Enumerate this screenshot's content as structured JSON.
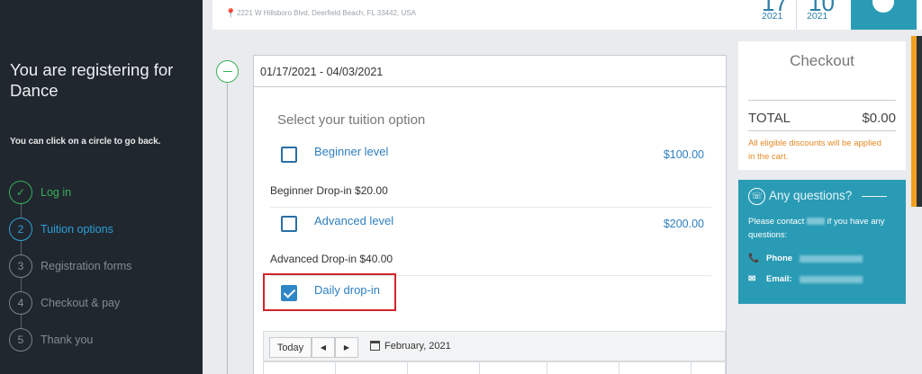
{
  "sidebar": {
    "title": "You are registering for Dance",
    "hint": "You can click on a circle to go back.",
    "steps": [
      {
        "num": "✓",
        "label": "Log in",
        "state": "done"
      },
      {
        "num": "2",
        "label": "Tuition options",
        "state": "active"
      },
      {
        "num": "3",
        "label": "Registration forms",
        "state": "upcoming"
      },
      {
        "num": "4",
        "label": "Checkout & pay",
        "state": "upcoming"
      },
      {
        "num": "5",
        "label": "Thank you",
        "state": "upcoming"
      }
    ]
  },
  "header": {
    "address": "2221 W Hillsboro Blvd, Deerfield Beach, FL 33442, USA",
    "start_day": "17",
    "start_year": "2021",
    "end_day": "10",
    "end_year": "2021"
  },
  "tuition": {
    "date_range": "01/17/2021 - 04/03/2021",
    "section_title": "Select your tuition option",
    "options": [
      {
        "name": "Beginner level",
        "price": "$100.00",
        "checked": false
      },
      {
        "name": "Advanced level",
        "price": "$200.00",
        "checked": false
      },
      {
        "name": "Daily drop-in",
        "price": "",
        "checked": true
      }
    ],
    "dropins": [
      "Beginner Drop-in $20.00",
      "Advanced Drop-in $40.00"
    ]
  },
  "calendar": {
    "today_label": "Today",
    "prev_symbol": "◀",
    "next_symbol": "▶",
    "month": "February, 2021"
  },
  "checkout": {
    "title": "Checkout",
    "total_label": "TOTAL",
    "total_amount": "$0.00",
    "discount_note": "All eligible discounts will be applied in the cart."
  },
  "questions": {
    "title": "Any questions?",
    "text_prefix": "Please contact",
    "text_suffix": "if you have any questions:",
    "phone_label": "Phone",
    "email_label": "Email:"
  },
  "colors": {
    "sidebar_bg": "#20272f",
    "done_green": "#3ab05a",
    "active_blue": "#2e9fd6",
    "teal": "#2a9bb5",
    "highlight_red": "#d2232a",
    "discount_orange": "#e48a26"
  }
}
